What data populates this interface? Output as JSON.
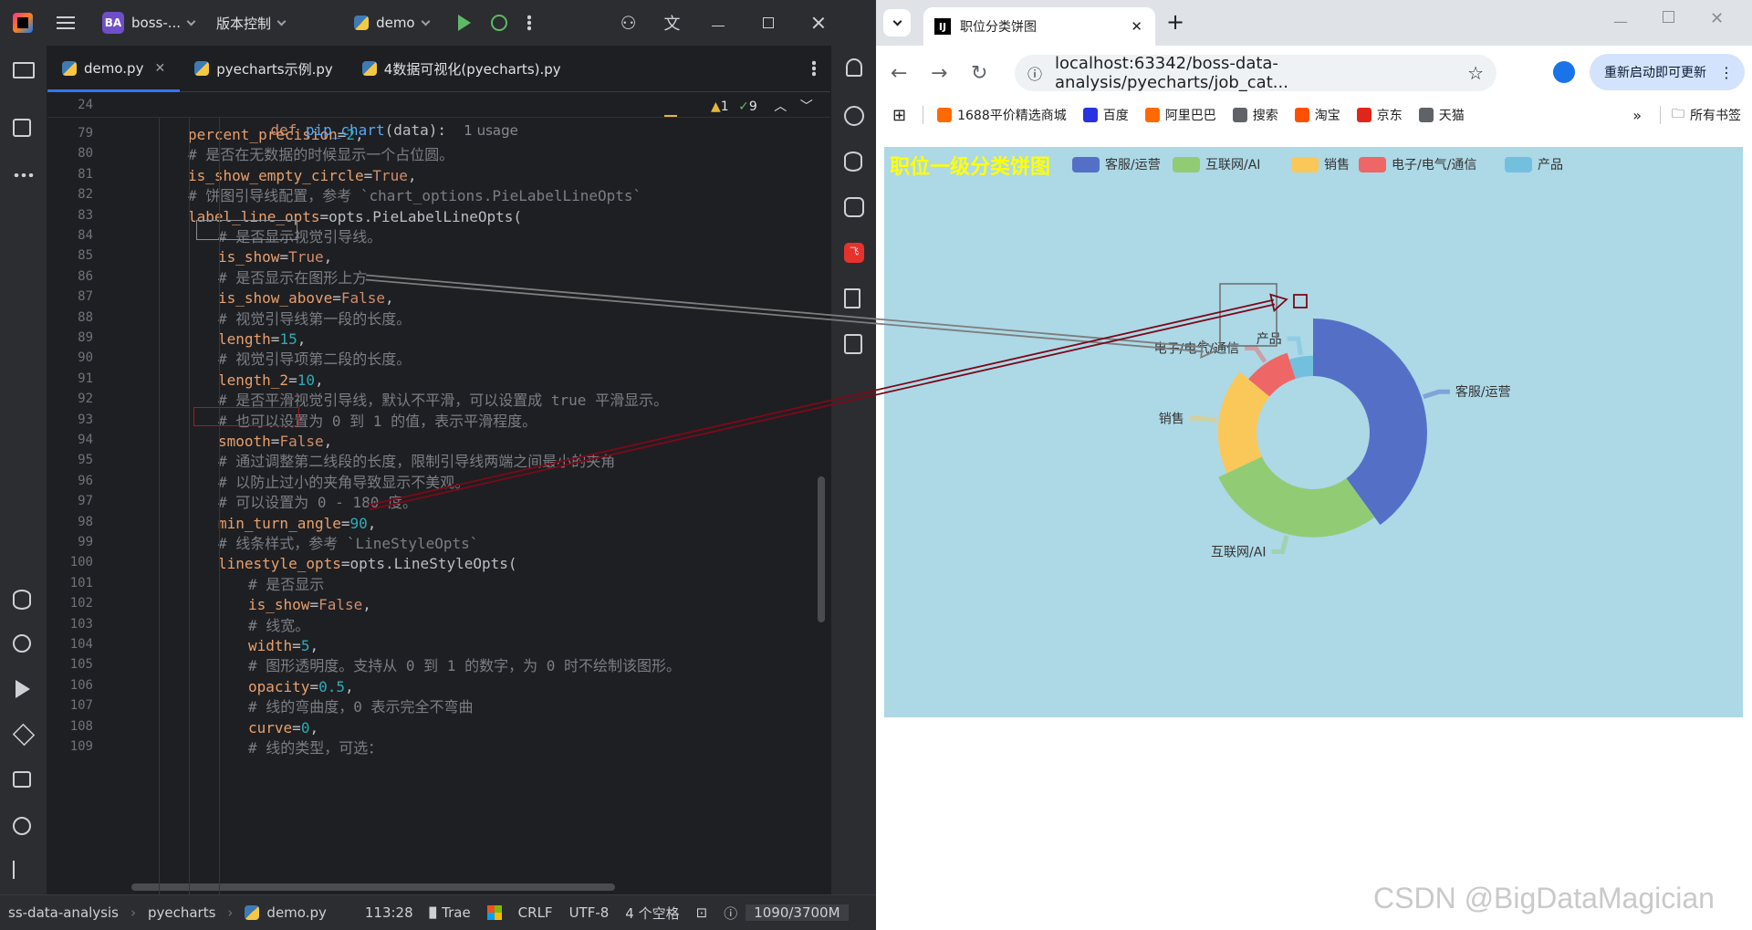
{
  "ide": {
    "project_name": "boss-...",
    "project_badge": "BA",
    "vcs_label": "版本控制",
    "run_config": "demo",
    "tabs": [
      {
        "label": "demo.py",
        "active": true
      },
      {
        "label": "pyecharts示例.py",
        "active": false
      },
      {
        "label": "4数据可视化(pyecharts).py",
        "active": false
      }
    ],
    "sticky": {
      "line": "24",
      "def_kw": "def",
      "fn_name": "pip_chart",
      "sig_rest": "(data):",
      "usage": "1 usage",
      "warnings": "1",
      "checks": "9"
    },
    "lines": [
      {
        "n": "79",
        "indent": 2,
        "parts": [
          [
            "param",
            "percent_precision"
          ],
          [
            "op",
            "="
          ],
          [
            "num",
            "2"
          ],
          [
            "op",
            ","
          ]
        ]
      },
      {
        "n": "80",
        "indent": 2,
        "parts": [
          [
            "cmt",
            "# 是否在无数据的时候显示一个占位圆。"
          ]
        ]
      },
      {
        "n": "81",
        "indent": 2,
        "parts": [
          [
            "param",
            "is_show_empty_circle"
          ],
          [
            "op",
            "="
          ],
          [
            "kw",
            "True"
          ],
          [
            "op",
            ","
          ]
        ]
      },
      {
        "n": "82",
        "indent": 2,
        "parts": [
          [
            "cmt",
            "# 饼图引导线配置，参考 `chart_options.PieLabelLineOpts`"
          ]
        ]
      },
      {
        "n": "83",
        "indent": 2,
        "parts": [
          [
            "param",
            "label_line_opts"
          ],
          [
            "op",
            "=opts.PieLabelLineOpts("
          ]
        ]
      },
      {
        "n": "84",
        "indent": 3,
        "parts": [
          [
            "cmt",
            "# 是否显示视觉引导线。"
          ]
        ]
      },
      {
        "n": "85",
        "indent": 3,
        "parts": [
          [
            "param",
            "is_show"
          ],
          [
            "op",
            "="
          ],
          [
            "kw",
            "True"
          ],
          [
            "op",
            ","
          ]
        ]
      },
      {
        "n": "86",
        "indent": 3,
        "parts": [
          [
            "cmt",
            "# 是否显示在图形上方"
          ]
        ]
      },
      {
        "n": "87",
        "indent": 3,
        "parts": [
          [
            "param",
            "is_show_above"
          ],
          [
            "op",
            "="
          ],
          [
            "kw",
            "False"
          ],
          [
            "op",
            ","
          ]
        ]
      },
      {
        "n": "88",
        "indent": 3,
        "parts": [
          [
            "cmt",
            "# 视觉引导线第一段的长度。"
          ]
        ]
      },
      {
        "n": "89",
        "indent": 3,
        "parts": [
          [
            "param",
            "length"
          ],
          [
            "op",
            "="
          ],
          [
            "num",
            "15"
          ],
          [
            "op",
            ","
          ]
        ]
      },
      {
        "n": "90",
        "indent": 3,
        "parts": [
          [
            "cmt",
            "# 视觉引导项第二段的长度。"
          ]
        ]
      },
      {
        "n": "91",
        "indent": 3,
        "parts": [
          [
            "param",
            "length_2"
          ],
          [
            "op",
            "="
          ],
          [
            "num",
            "10"
          ],
          [
            "op",
            ","
          ]
        ]
      },
      {
        "n": "92",
        "indent": 3,
        "parts": [
          [
            "cmt",
            "# 是否平滑视觉引导线，默认不平滑，可以设置成 true 平滑显示。"
          ]
        ]
      },
      {
        "n": "93",
        "indent": 3,
        "parts": [
          [
            "cmt",
            "# 也可以设置为 0 到 1 的值，表示平滑程度。"
          ]
        ]
      },
      {
        "n": "94",
        "indent": 3,
        "parts": [
          [
            "param",
            "smooth"
          ],
          [
            "op",
            "="
          ],
          [
            "kw",
            "False"
          ],
          [
            "op",
            ","
          ]
        ]
      },
      {
        "n": "95",
        "indent": 3,
        "parts": [
          [
            "cmt",
            "# 通过调整第二线段的长度，限制引导线两端之间最小的夹角"
          ]
        ]
      },
      {
        "n": "96",
        "indent": 3,
        "parts": [
          [
            "cmt",
            "# 以防止过小的夹角导致显示不美观。"
          ]
        ]
      },
      {
        "n": "97",
        "indent": 3,
        "parts": [
          [
            "cmt",
            "# 可以设置为 0 - 180 度。"
          ]
        ]
      },
      {
        "n": "98",
        "indent": 3,
        "parts": [
          [
            "param",
            "min_turn_angle"
          ],
          [
            "op",
            "="
          ],
          [
            "num",
            "90"
          ],
          [
            "op",
            ","
          ]
        ]
      },
      {
        "n": "99",
        "indent": 3,
        "parts": [
          [
            "cmt",
            "# 线条样式，参考 `LineStyleOpts`"
          ]
        ]
      },
      {
        "n": "100",
        "indent": 3,
        "parts": [
          [
            "param",
            "linestyle_opts"
          ],
          [
            "op",
            "=opts.LineStyleOpts("
          ]
        ]
      },
      {
        "n": "101",
        "indent": 4,
        "parts": [
          [
            "cmt",
            "# 是否显示"
          ]
        ]
      },
      {
        "n": "102",
        "indent": 4,
        "parts": [
          [
            "param",
            "is_show"
          ],
          [
            "op",
            "="
          ],
          [
            "kw",
            "False"
          ],
          [
            "op",
            ","
          ]
        ]
      },
      {
        "n": "103",
        "indent": 4,
        "parts": [
          [
            "cmt",
            "# 线宽。"
          ]
        ]
      },
      {
        "n": "104",
        "indent": 4,
        "parts": [
          [
            "param",
            "width"
          ],
          [
            "op",
            "="
          ],
          [
            "num",
            "5"
          ],
          [
            "op",
            ","
          ]
        ]
      },
      {
        "n": "105",
        "indent": 4,
        "parts": [
          [
            "cmt",
            "# 图形透明度。支持从 0 到 1 的数字，为 0 时不绘制该图形。"
          ]
        ]
      },
      {
        "n": "106",
        "indent": 4,
        "parts": [
          [
            "param",
            "opacity"
          ],
          [
            "op",
            "="
          ],
          [
            "num",
            "0.5"
          ],
          [
            "op",
            ","
          ]
        ]
      },
      {
        "n": "107",
        "indent": 4,
        "parts": [
          [
            "cmt",
            "# 线的弯曲度，0 表示完全不弯曲"
          ]
        ]
      },
      {
        "n": "108",
        "indent": 4,
        "parts": [
          [
            "param",
            "curve"
          ],
          [
            "op",
            "="
          ],
          [
            "num",
            "0"
          ],
          [
            "op",
            ","
          ]
        ]
      },
      {
        "n": "109",
        "indent": 4,
        "parts": [
          [
            "cmt",
            "# 线的类型，可选："
          ]
        ]
      }
    ],
    "status": {
      "path_project": "ss-data-analysis",
      "path_folder": "pyecharts",
      "path_file": "demo.py",
      "position": "113:28",
      "plugin": "Trae",
      "line_sep": "CRLF",
      "encoding": "UTF-8",
      "indent": "4 个空格",
      "memory": "1090/3700M"
    }
  },
  "browser": {
    "tab_title": "职位分类饼图",
    "tab_favicon": "IJ",
    "url": "localhost:63342/boss-data-analysis/pyecharts/job_cat...",
    "update_button": "重新启动即可更新",
    "bookmarks": [
      "1688平价精选商城",
      "百度",
      "阿里巴巴",
      "搜索",
      "淘宝",
      "京东",
      "天猫"
    ],
    "all_bookmarks": "所有书签"
  },
  "chart_data": {
    "type": "pie",
    "variant": "ring",
    "title": "职位一级分类饼图",
    "title_color": "#ffff00",
    "background": "#add8e6",
    "legend_position": "top",
    "slices": [
      {
        "name": "客服/运营",
        "value": 40,
        "color": "#5470c6"
      },
      {
        "name": "互联网/AI",
        "value": 28,
        "color": "#91cc75"
      },
      {
        "name": "销售",
        "value": 18,
        "color": "#fac858"
      },
      {
        "name": "电子/电气/通信",
        "value": 9,
        "color": "#ee6666"
      },
      {
        "name": "产品",
        "value": 5,
        "color": "#73c0de"
      }
    ],
    "label_line": {
      "show": true,
      "smooth": false
    }
  },
  "watermark": "CSDN @BigDataMagician"
}
